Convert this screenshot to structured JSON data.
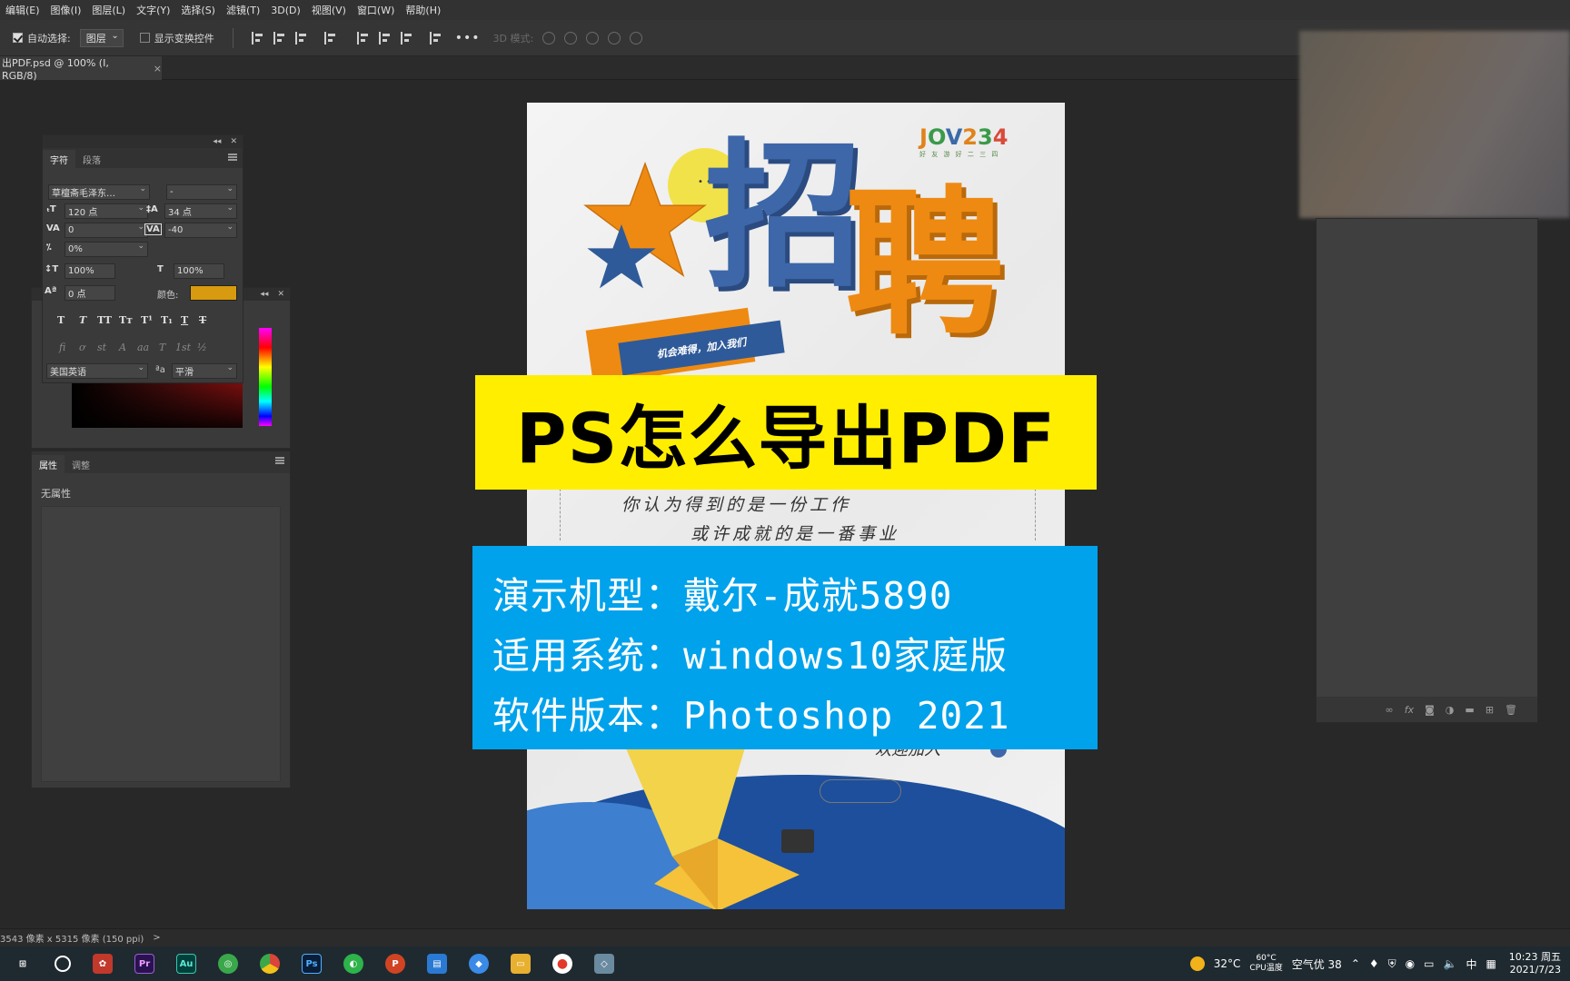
{
  "menu": [
    "编辑(E)",
    "图像(I)",
    "图层(L)",
    "文字(Y)",
    "选择(S)",
    "滤镜(T)",
    "3D(D)",
    "视图(V)",
    "窗口(W)",
    "帮助(H)"
  ],
  "options": {
    "auto_select_label": "自动选择:",
    "auto_select_target": "图层",
    "show_transform_label": "显示变换控件",
    "more": "•••",
    "mode_3d_label": "3D 模式:"
  },
  "document_tab": {
    "title": "出PDF.psd @ 100% (I, RGB/8)",
    "close": "×"
  },
  "character_panel": {
    "tabs": [
      "字符",
      "段落"
    ],
    "font_family": "草檀斋毛泽东…",
    "font_style": "-",
    "font_size": "120 点",
    "leading": "34 点",
    "kerning": "0",
    "tracking": "-40",
    "scale_percent": "0%",
    "vertical_scale": "100%",
    "horizontal_scale": "100%",
    "baseline_shift": "0 点",
    "color_label": "颜色:",
    "color": "#d89a0f",
    "language": "美国英语",
    "antialias": "平滑",
    "aa_label": "ªa"
  },
  "properties_panel": {
    "tabs": [
      "属性",
      "调整"
    ],
    "empty_text": "无属性"
  },
  "poster": {
    "logo": [
      "J",
      "O",
      "V",
      "2",
      "3",
      "4"
    ],
    "logo_sub": "好 友 游 好 二 三 四",
    "title_blue": "招",
    "title_orange": "聘",
    "ribbon_text": "机会难得，加入我们",
    "line1": "你认为得到的是一份工作",
    "line2": "或许成就的是一番事业",
    "welcome": "欢迎加入"
  },
  "overlay": {
    "headline": "PS怎么导出PDF",
    "info_lines": [
      "演示机型：戴尔-成就5890",
      "适用系统：windows10家庭版",
      "软件版本：Photoshop 2021"
    ]
  },
  "status": {
    "doc_size": "3543 像素 x 5315 像素 (150 ppi)",
    "arrow": ">"
  },
  "taskbar": {
    "apps": [
      {
        "name": "task-view",
        "label": "⊞",
        "color": "#1f2a30"
      },
      {
        "name": "search",
        "label": "○",
        "color": "#1f2a30"
      },
      {
        "name": "app-red",
        "label": "✿",
        "color": "#c0392b"
      },
      {
        "name": "premiere",
        "label": "Pr",
        "color": "#2a1250"
      },
      {
        "name": "audition",
        "label": "Au",
        "color": "#00403c"
      },
      {
        "name": "app-green",
        "label": "◎",
        "color": "#3aa84a"
      },
      {
        "name": "chrome",
        "label": "●",
        "color": "#d9453a"
      },
      {
        "name": "photoshop",
        "label": "Ps",
        "color": "#0a1e3a"
      },
      {
        "name": "wechat",
        "label": "◐",
        "color": "#2db34a"
      },
      {
        "name": "powerpoint",
        "label": "P",
        "color": "#d04423"
      },
      {
        "name": "app-blue",
        "label": "▤",
        "color": "#2a7ad4"
      },
      {
        "name": "app-lark",
        "label": "◆",
        "color": "#3a8ae8"
      },
      {
        "name": "explorer",
        "label": "▭",
        "color": "#e8b030"
      },
      {
        "name": "recorder",
        "label": "●",
        "color": "#e23a2a"
      },
      {
        "name": "app-notes",
        "label": "◇",
        "color": "#6a8aa0"
      }
    ],
    "weather_temp": "32°C",
    "weather_desc": "空气优 38",
    "cpu_temp": "60°C",
    "cpu_label": "CPU温度",
    "ime": "中",
    "time": "10:23 周五",
    "date": "2021/7/23"
  }
}
